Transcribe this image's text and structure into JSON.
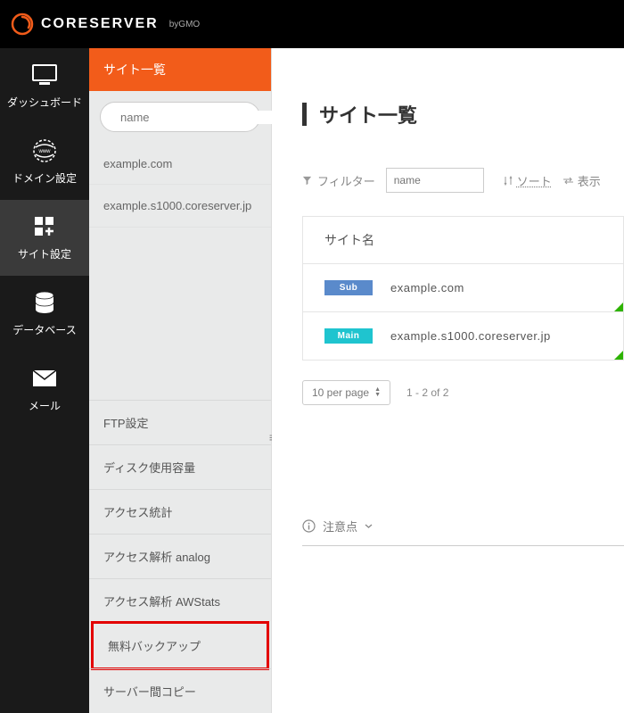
{
  "brand": {
    "name": "CORESERVER",
    "suffix": "byGMO"
  },
  "nav": [
    {
      "label": "ダッシュボード",
      "icon": "monitor"
    },
    {
      "label": "ドメイン設定",
      "icon": "globe"
    },
    {
      "label": "サイト設定",
      "icon": "grid-plus",
      "active": true
    },
    {
      "label": "データベース",
      "icon": "database"
    },
    {
      "label": "メール",
      "icon": "mail"
    }
  ],
  "subnav": {
    "title": "サイト一覧",
    "filter_placeholder": "name",
    "sites": [
      "example.com",
      "example.s1000.coreserver.jp"
    ],
    "tools": [
      {
        "label": "FTP設定"
      },
      {
        "label": "ディスク使用容量"
      },
      {
        "label": "アクセス統計"
      },
      {
        "label": "アクセス解析 analog"
      },
      {
        "label": "アクセス解析 AWStats"
      },
      {
        "label": "無料バックアップ",
        "highlighted": true
      },
      {
        "label": "サーバー間コピー"
      }
    ]
  },
  "main": {
    "title": "サイト一覧",
    "filter_label": "フィルター",
    "filter_placeholder": "name",
    "sort_label": "ソート",
    "display_label": "表示",
    "table_header": "サイト名",
    "rows": [
      {
        "badge": "Sub",
        "badge_class": "badge-sub",
        "domain": "example.com"
      },
      {
        "badge": "Main",
        "badge_class": "badge-main",
        "domain": "example.s1000.coreserver.jp"
      }
    ],
    "per_page": "10 per page",
    "page_info": "1 - 2 of 2",
    "notes_label": "注意点"
  }
}
